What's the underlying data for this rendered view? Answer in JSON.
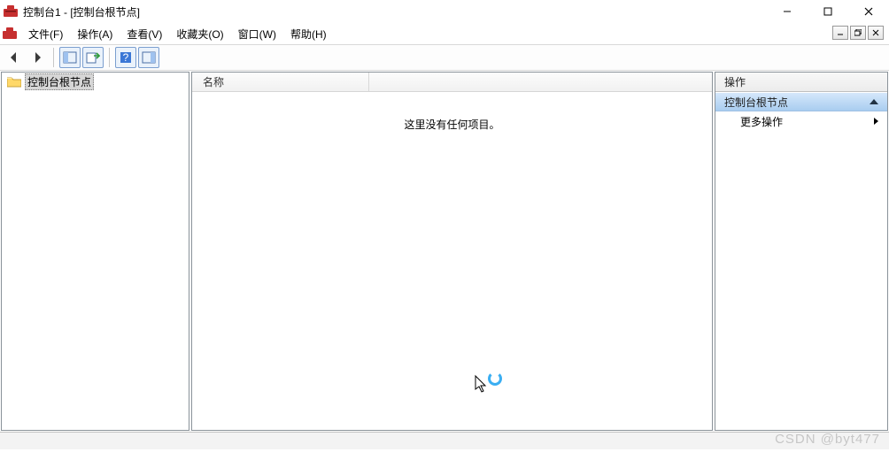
{
  "window": {
    "title": "控制台1 - [控制台根节点]"
  },
  "menu": {
    "file": "文件(F)",
    "action": "操作(A)",
    "view": "查看(V)",
    "fav": "收藏夹(O)",
    "window": "窗口(W)",
    "help": "帮助(H)"
  },
  "tree": {
    "root": "控制台根节点"
  },
  "list": {
    "col_name": "名称",
    "empty": "这里没有任何项目。"
  },
  "actions": {
    "header": "操作",
    "section": "控制台根节点",
    "more": "更多操作"
  },
  "watermark": "CSDN @byt477"
}
